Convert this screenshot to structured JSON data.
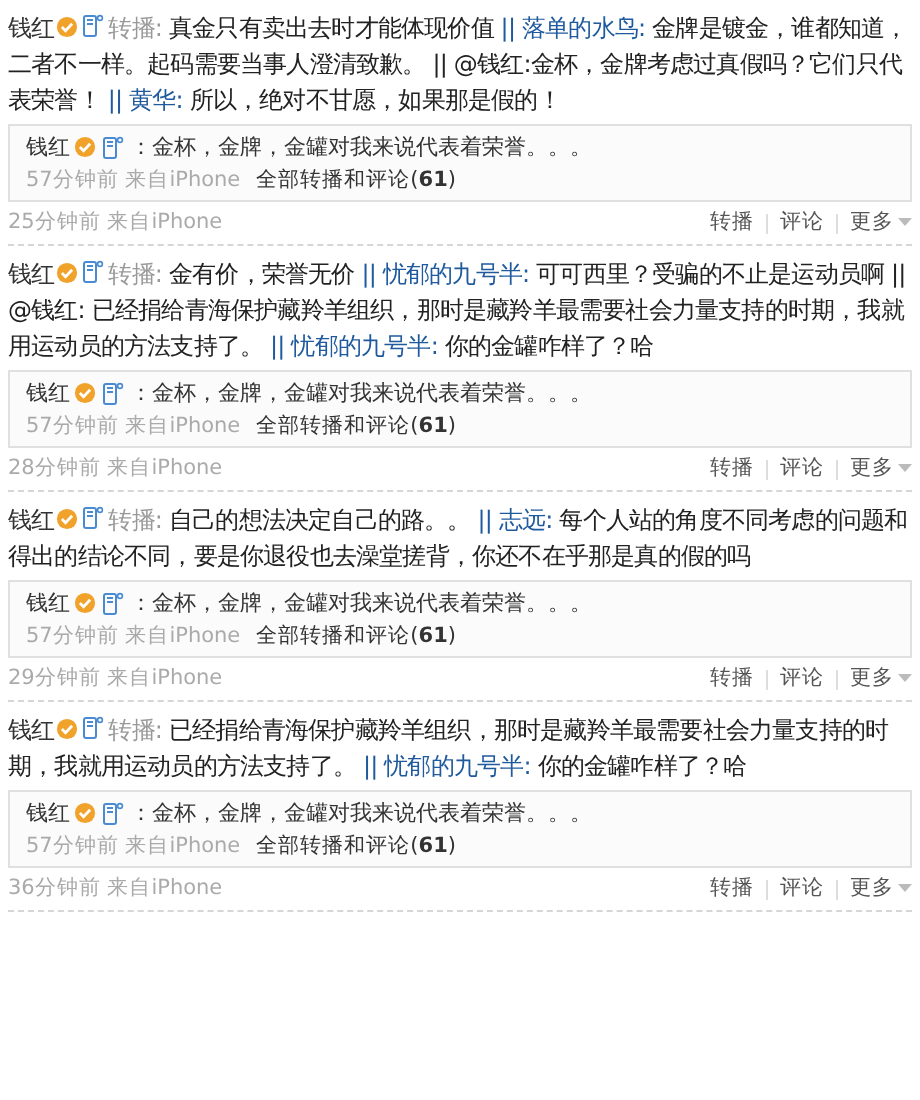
{
  "posts": [
    {
      "author": "钱红",
      "action": "转播:",
      "segments": [
        {
          "kind": "text",
          "text": "真金只有卖出去时才能体现价值"
        },
        {
          "kind": "link",
          "text": "|| 落单的水鸟:"
        },
        {
          "kind": "text",
          "text": "金牌是镀金，谁都知道，二者不一样。起码需要当事人澄清致歉。 || @钱红:金杯，金牌考虑过真假吗？它们只代表荣誉！"
        },
        {
          "kind": "link",
          "text": "|| 黄华:"
        },
        {
          "kind": "text",
          "text": "所以，绝对不甘愿，如果那是假的！"
        }
      ],
      "quote": {
        "author": "钱红",
        "text": "：金杯，金牌，金罐对我来说代表着荣誉。。。",
        "meta": "57分钟前 来自iPhone",
        "link": "全部转播和评论(**61**)"
      },
      "meta": "25分钟前 来自iPhone",
      "actions": [
        "转播",
        "评论",
        "更多"
      ]
    },
    {
      "author": "钱红",
      "action": "转播:",
      "segments": [
        {
          "kind": "text",
          "text": "金有价，荣誉无价"
        },
        {
          "kind": "link",
          "text": "|| 忧郁的九号半:"
        },
        {
          "kind": "text",
          "text": "可可西里？受骗的不止是运动员啊 || @钱红: 已经捐给青海保护藏羚羊组织，那时是藏羚羊最需要社会力量支持的时期，我就用运动员的方法支持了。"
        },
        {
          "kind": "link",
          "text": "|| 忧郁的九号半:"
        },
        {
          "kind": "text",
          "text": "你的金罐咋样了？哈"
        }
      ],
      "quote": {
        "author": "钱红",
        "text": "：金杯，金牌，金罐对我来说代表着荣誉。。。",
        "meta": "57分钟前 来自iPhone",
        "link": "全部转播和评论(**61**)"
      },
      "meta": "28分钟前 来自iPhone",
      "actions": [
        "转播",
        "评论",
        "更多"
      ]
    },
    {
      "author": "钱红",
      "action": "转播:",
      "segments": [
        {
          "kind": "text",
          "text": "自己的想法决定自己的路。。"
        },
        {
          "kind": "link",
          "text": "|| 志远:"
        },
        {
          "kind": "text",
          "text": "每个人站的角度不同考虑的问题和得出的结论不同，要是你退役也去澡堂搓背，你还不在乎那是真的假的吗"
        }
      ],
      "quote": {
        "author": "钱红",
        "text": "：金杯，金牌，金罐对我来说代表着荣誉。。。",
        "meta": "57分钟前 来自iPhone",
        "link": "全部转播和评论(**61**)"
      },
      "meta": "29分钟前 来自iPhone",
      "actions": [
        "转播",
        "评论",
        "更多"
      ]
    },
    {
      "author": "钱红",
      "action": "转播:",
      "segments": [
        {
          "kind": "text",
          "text": "已经捐给青海保护藏羚羊组织，那时是藏羚羊最需要社会力量支持的时期，我就用运动员的方法支持了。"
        },
        {
          "kind": "link",
          "text": "|| 忧郁的九号半:"
        },
        {
          "kind": "text",
          "text": "你的金罐咋样了？哈"
        }
      ],
      "quote": {
        "author": "钱红",
        "text": "：金杯，金牌，金罐对我来说代表着荣誉。。。",
        "meta": "57分钟前 来自iPhone",
        "link": "全部转播和评论(**61**)"
      },
      "meta": "36分钟前 来自iPhone",
      "actions": [
        "转播",
        "评论",
        "更多"
      ]
    }
  ]
}
